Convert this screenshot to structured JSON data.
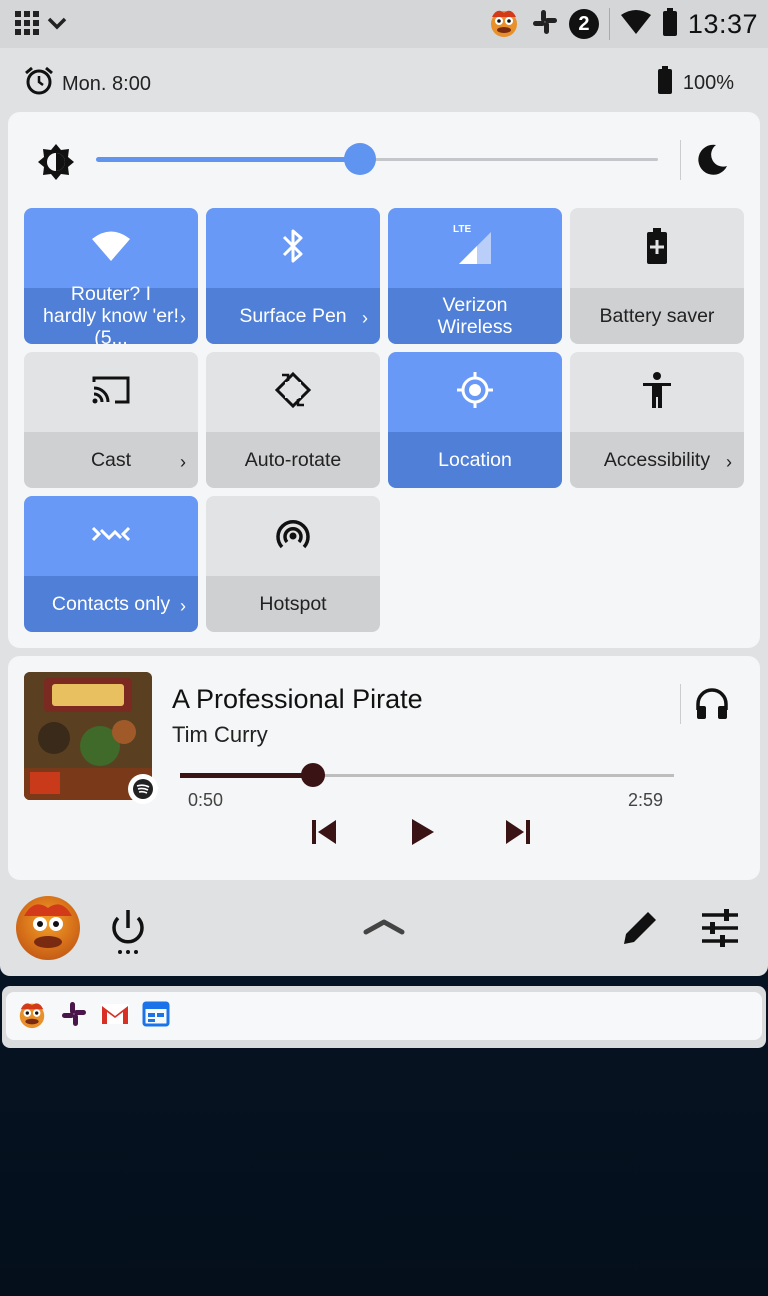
{
  "status_bar": {
    "time": "13:37",
    "notification_count": "2",
    "icons": [
      "apps-grid-icon",
      "chevron-down-icon",
      "muppet-app-icon",
      "slack-icon",
      "wifi-icon",
      "battery-icon"
    ]
  },
  "info_row": {
    "alarm_text": "Mon. 8:00",
    "battery_text": "100%"
  },
  "quick_settings": {
    "brightness_level": 0.47,
    "tiles": [
      {
        "label": "Router? I hardly know 'er! (5...",
        "state": "on",
        "icon": "wifi-icon",
        "has_chevron": true
      },
      {
        "label": "Surface Pen",
        "state": "on",
        "icon": "bluetooth-icon",
        "has_chevron": true
      },
      {
        "label": "Verizon Wireless",
        "state": "on",
        "icon": "lte-signal-icon",
        "has_chevron": false,
        "icon_text": "LTE"
      },
      {
        "label": "Battery saver",
        "state": "off",
        "icon": "battery-saver-icon",
        "has_chevron": false
      },
      {
        "label": "Cast",
        "state": "off",
        "icon": "cast-icon",
        "has_chevron": true
      },
      {
        "label": "Auto-rotate",
        "state": "off",
        "icon": "rotate-icon",
        "has_chevron": false
      },
      {
        "label": "Location",
        "state": "on",
        "icon": "location-icon",
        "has_chevron": false
      },
      {
        "label": "Accessibility",
        "state": "off",
        "icon": "accessibility-icon",
        "has_chevron": true
      },
      {
        "label": "Contacts only",
        "state": "on",
        "icon": "nearby-share-icon",
        "has_chevron": true
      },
      {
        "label": "Hotspot",
        "state": "off",
        "icon": "hotspot-icon",
        "has_chevron": false
      }
    ],
    "chevron": "›"
  },
  "media": {
    "title": "A Professional Pirate",
    "artist": "Tim Curry",
    "current_time": "0:50",
    "total_time": "2:59",
    "progress": 0.27,
    "source_icon": "spotify-icon",
    "output_icon": "headphones-icon"
  },
  "bottom_row": {
    "icons": [
      "avatar",
      "power-icon",
      "collapse-chevron-icon",
      "edit-icon",
      "settings-sliders-icon"
    ]
  },
  "notification_strip": {
    "icons": [
      "muppet-app-icon",
      "slack-icon",
      "gmail-icon",
      "calendar-icon"
    ]
  },
  "colors": {
    "tile_on_top": "#6899f6",
    "tile_on_bottom": "#4f7fd6",
    "tile_off_top": "#e2e3e5",
    "tile_off_bottom": "#cfd0d2",
    "media_accent": "#3a1414"
  }
}
